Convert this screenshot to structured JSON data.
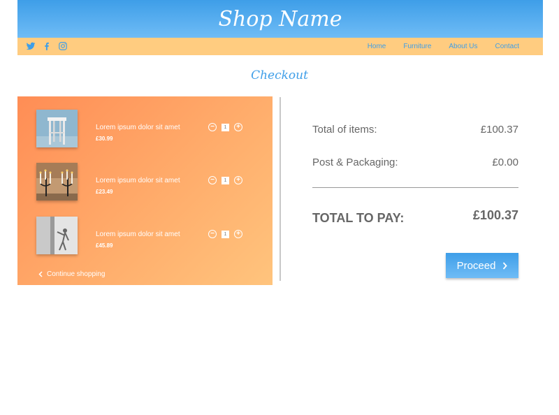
{
  "header": {
    "shop_name": "Shop Name"
  },
  "nav": {
    "social": [
      "twitter-icon",
      "facebook-icon",
      "instagram-icon"
    ],
    "links": [
      "Home",
      "Furniture",
      "About Us",
      "Contact"
    ]
  },
  "page": {
    "title": "Checkout"
  },
  "cart": {
    "items": [
      {
        "name": "Lorem ipsum dolor sit amet",
        "price": "£30.99",
        "quantity": "1",
        "image": "stool-photo"
      },
      {
        "name": "Lorem ipsum dolor sit amet",
        "price": "£23.49",
        "quantity": "1",
        "image": "candelabra-photo"
      },
      {
        "name": "Lorem ipsum dolor sit amet",
        "price": "£45.89",
        "quantity": "1",
        "image": "figurine-photo"
      }
    ],
    "continue_label": "Continue shopping"
  },
  "summary": {
    "items_label": "Total of items:",
    "items_value": "£100.37",
    "postage_label": "Post & Packaging:",
    "postage_value": "£0.00",
    "total_label": "TOTAL TO PAY:",
    "total_value": "£100.37"
  },
  "actions": {
    "proceed_label": "Proceed"
  },
  "colors": {
    "primary": "#3e9ee8",
    "nav_bar": "#ffcc80",
    "cart_gradient_start": "#ff8d55",
    "cart_gradient_end": "#ffc47d"
  }
}
